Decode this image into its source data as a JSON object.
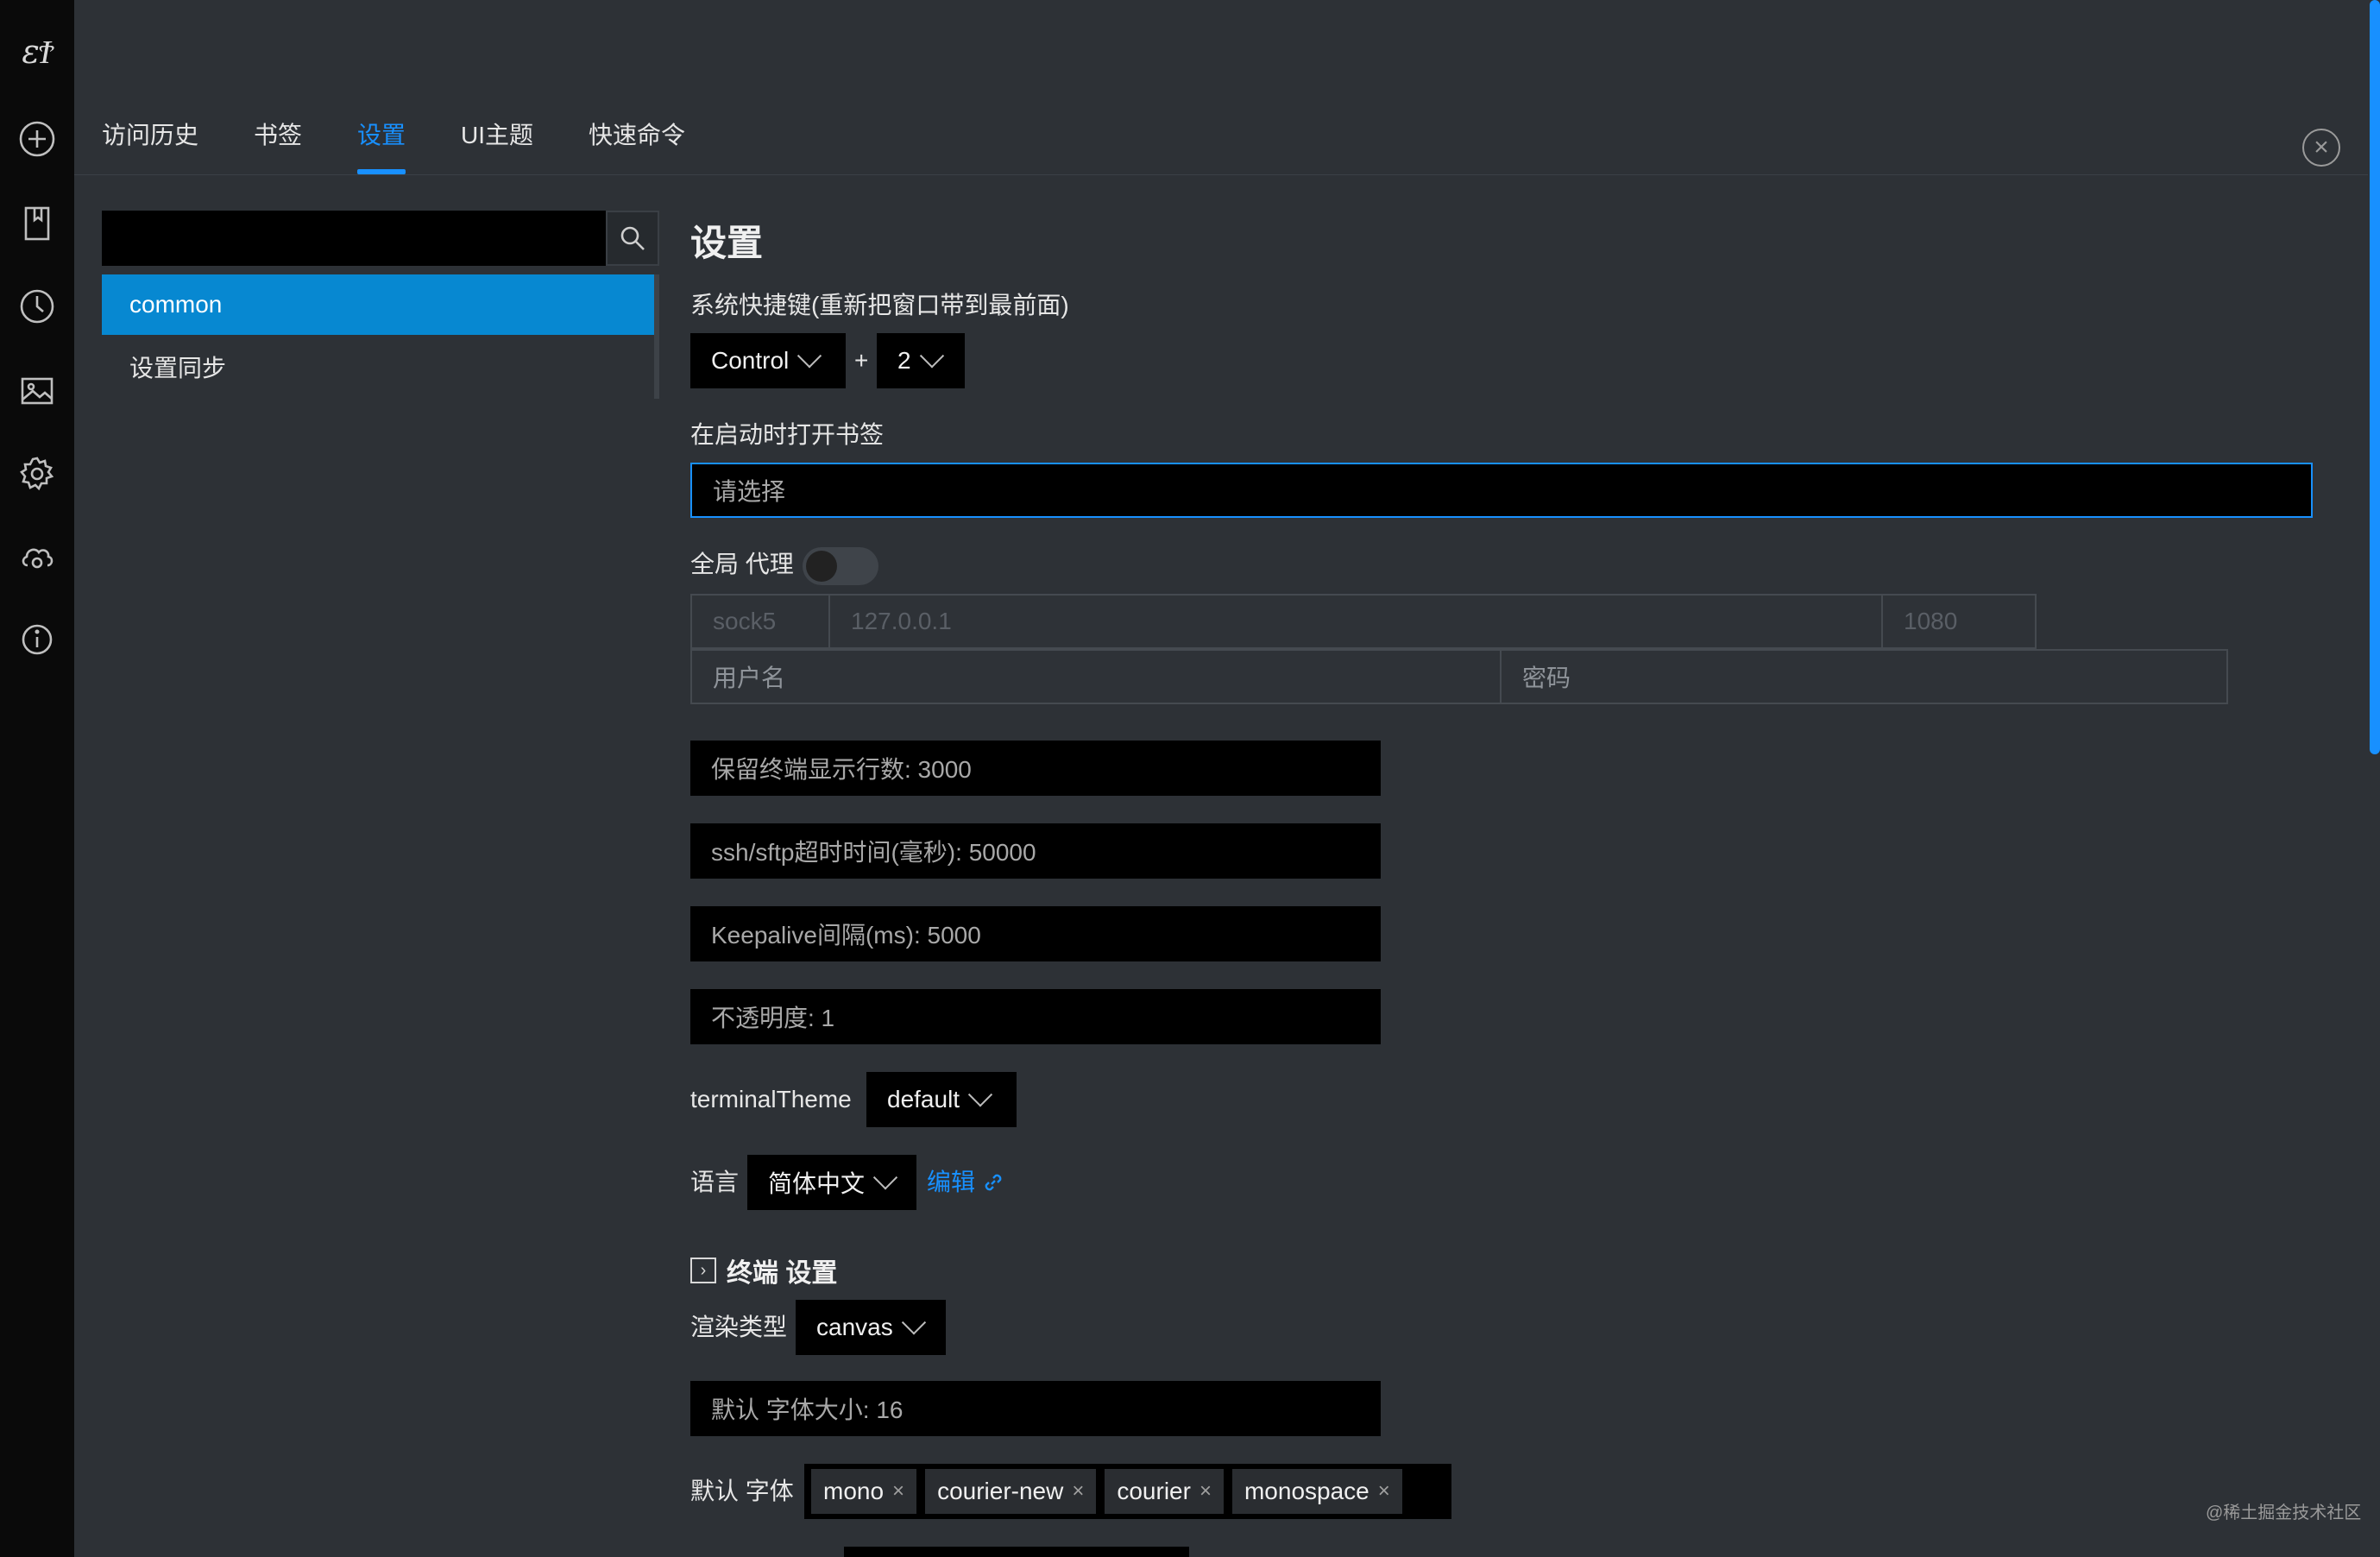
{
  "rail": {
    "logo": "ɛϮ"
  },
  "tabs": [
    {
      "label": "访问历史"
    },
    {
      "label": "书签"
    },
    {
      "label": "设置"
    },
    {
      "label": "UI主题"
    },
    {
      "label": "快速命令"
    }
  ],
  "sidebar": {
    "search": {
      "placeholder": ""
    },
    "items": [
      {
        "label": "common"
      },
      {
        "label": "设置同步"
      }
    ]
  },
  "main": {
    "title": "设置",
    "hotkey": {
      "label": "系统快捷键(重新把窗口带到最前面)",
      "modifier": "Control",
      "plus": "+",
      "key": "2"
    },
    "startup": {
      "label": "在启动时打开书签",
      "placeholder": "请选择"
    },
    "proxy": {
      "label": "全局 代理",
      "type": "sock5",
      "host": "127.0.0.1",
      "port": "1080",
      "username_placeholder": "用户名",
      "password_placeholder": "密码"
    },
    "fields": {
      "scrollback": "保留终端显示行数: 3000",
      "timeout": "ssh/sftp超时时间(毫秒): 50000",
      "keepalive": "Keepalive间隔(ms): 5000",
      "opacity": "不透明度: 1"
    },
    "terminal_theme": {
      "label": "terminalTheme",
      "value": "default"
    },
    "language": {
      "label": "语言",
      "value": "简体中文",
      "edit": "编辑"
    },
    "terminal_section": {
      "title": "终端 设置",
      "renderer_label": "渲染类型",
      "renderer_value": "canvas",
      "font_size": "默认 字体大小: 16",
      "font_label": "默认 字体",
      "fonts": [
        "mono",
        "courier-new",
        "courier",
        "monospace"
      ]
    }
  },
  "watermark": "@稀土掘金技术社区",
  "colors": {
    "accent": "#1890ff",
    "background": "#2d3136",
    "rail": "#0a0a0a",
    "field": "#000000"
  }
}
